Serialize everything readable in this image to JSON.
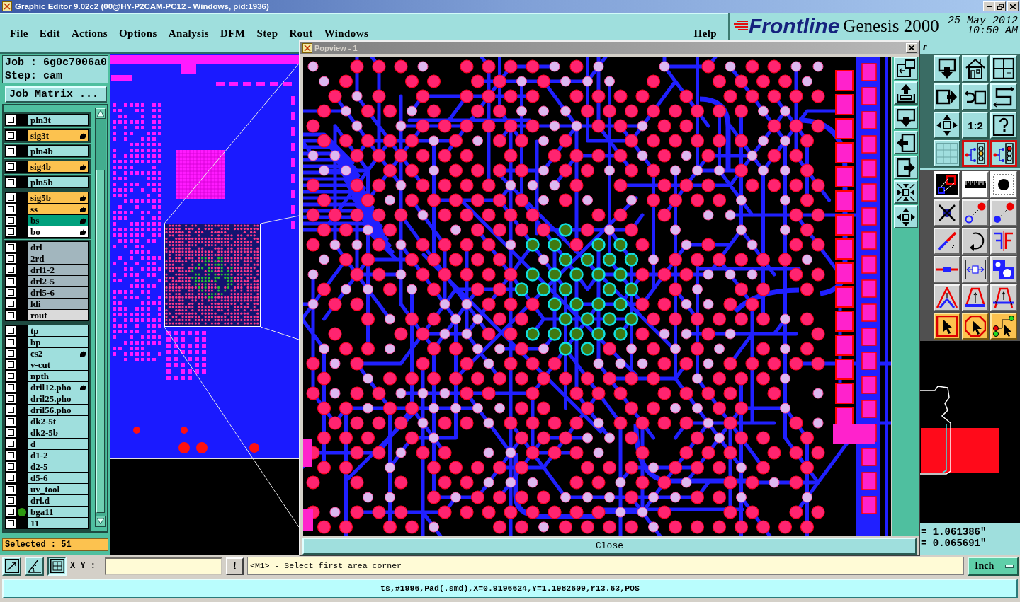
{
  "window": {
    "title": "Graphic Editor 9.02c2 (00@HY-P2CAM-PC12 - Windows, pid:1936)"
  },
  "menu": [
    "File",
    "Edit",
    "Actions",
    "Options",
    "Analysis",
    "DFM",
    "Step",
    "Rout",
    "Windows"
  ],
  "help_menu": "Help",
  "brand": {
    "logo": "Frontline",
    "product": "Genesis 2000",
    "date": "25 May 2012",
    "time": "10:50 AM",
    "subtitle": "r"
  },
  "job_panel": {
    "job": "Job : 6g0c7006a0",
    "step": "Step: cam",
    "matrix_button": "Job Matrix ...",
    "layer_groups": [
      {
        "layers": [
          {
            "name": "pln3t",
            "color": "#9fdfdd",
            "checked": false,
            "marked": false,
            "displayed": false
          }
        ]
      },
      {
        "layers": [
          {
            "name": "sig3t",
            "color": "#fcc24f",
            "checked": false,
            "marked": true,
            "displayed": false
          }
        ]
      },
      {
        "layers": [
          {
            "name": "pln4b",
            "color": "#9fdfdd",
            "checked": false,
            "marked": false,
            "displayed": false
          }
        ]
      },
      {
        "layers": [
          {
            "name": "sig4b",
            "color": "#fcc24f",
            "checked": false,
            "marked": true,
            "displayed": false
          }
        ]
      },
      {
        "layers": [
          {
            "name": "pln5b",
            "color": "#9fdfdd",
            "checked": false,
            "marked": false,
            "displayed": false
          }
        ]
      },
      {
        "layers": [
          {
            "name": "sig5b",
            "color": "#fcc24f",
            "checked": false,
            "marked": true,
            "displayed": false
          },
          {
            "name": "ss",
            "color": "#fcc24f",
            "checked": false,
            "marked": true,
            "displayed": false
          },
          {
            "name": "bs",
            "color": "#00a07c",
            "checked": false,
            "marked": true,
            "displayed": false
          },
          {
            "name": "bo",
            "color": "#ffffff",
            "checked": false,
            "marked": true,
            "displayed": false
          }
        ]
      },
      {
        "layers": [
          {
            "name": "drl",
            "color": "#a2b6be",
            "checked": false,
            "marked": false,
            "displayed": false
          },
          {
            "name": "2rd",
            "color": "#a2b6be",
            "checked": false,
            "marked": false,
            "displayed": false
          },
          {
            "name": "drl1-2",
            "color": "#a2b6be",
            "checked": false,
            "marked": false,
            "displayed": false
          },
          {
            "name": "drl2-5",
            "color": "#a2b6be",
            "checked": false,
            "marked": false,
            "displayed": false
          },
          {
            "name": "drl5-6",
            "color": "#a2b6be",
            "checked": false,
            "marked": false,
            "displayed": false
          },
          {
            "name": "ldi",
            "color": "#a2b6be",
            "checked": false,
            "marked": false,
            "displayed": false
          },
          {
            "name": "rout",
            "color": "#dadada",
            "checked": false,
            "marked": false,
            "displayed": false
          }
        ]
      },
      {
        "layers": [
          {
            "name": "tp",
            "color": "#9fdfdd",
            "checked": false,
            "marked": false,
            "displayed": false
          },
          {
            "name": "bp",
            "color": "#9fdfdd",
            "checked": false,
            "marked": false,
            "displayed": false
          },
          {
            "name": "cs2",
            "color": "#9fdfdd",
            "checked": false,
            "marked": true,
            "displayed": false
          },
          {
            "name": "v-cut",
            "color": "#9fdfdd",
            "checked": false,
            "marked": false,
            "displayed": false
          },
          {
            "name": "npth",
            "color": "#9fdfdd",
            "checked": false,
            "marked": false,
            "displayed": false
          },
          {
            "name": "dril12.pho",
            "color": "#9fdfdd",
            "checked": false,
            "marked": true,
            "displayed": false
          },
          {
            "name": "dril25.pho",
            "color": "#9fdfdd",
            "checked": false,
            "marked": false,
            "displayed": false
          },
          {
            "name": "dril56.pho",
            "color": "#9fdfdd",
            "checked": false,
            "marked": false,
            "displayed": false
          },
          {
            "name": "dk2-5t",
            "color": "#9fdfdd",
            "checked": false,
            "marked": false,
            "displayed": false
          },
          {
            "name": "dk2-5b",
            "color": "#9fdfdd",
            "checked": false,
            "marked": false,
            "displayed": false
          },
          {
            "name": "d",
            "color": "#9fdfdd",
            "checked": false,
            "marked": false,
            "displayed": false
          },
          {
            "name": "d1-2",
            "color": "#9fdfdd",
            "checked": false,
            "marked": false,
            "displayed": false
          },
          {
            "name": "d2-5",
            "color": "#9fdfdd",
            "checked": false,
            "marked": false,
            "displayed": false
          },
          {
            "name": "d5-6",
            "color": "#9fdfdd",
            "checked": false,
            "marked": false,
            "displayed": false
          },
          {
            "name": "uv_tool",
            "color": "#9fdfdd",
            "checked": false,
            "marked": false,
            "displayed": false
          },
          {
            "name": "drl.d",
            "color": "#9fdfdd",
            "checked": false,
            "marked": false,
            "displayed": false
          },
          {
            "name": "bga11",
            "color": "#9fdfdd",
            "checked": false,
            "marked": false,
            "displayed": true
          },
          {
            "name": "11",
            "color": "#9fdfdd",
            "checked": false,
            "marked": false,
            "displayed": false
          }
        ]
      }
    ],
    "selected": "Selected : 51"
  },
  "tool_palette": [
    {
      "kind": "view",
      "on": false
    },
    {
      "kind": "view",
      "on": false
    },
    {
      "kind": "view",
      "on": false
    },
    {
      "kind": "view",
      "on": false
    },
    {
      "kind": "view",
      "on": false
    },
    {
      "kind": "view",
      "on": false
    },
    {
      "kind": "view",
      "on": false
    },
    {
      "kind": "view",
      "label": "1:2",
      "on": false
    },
    {
      "kind": "view",
      "on": false
    },
    {
      "kind": "view",
      "on": false
    },
    {
      "kind": "view",
      "on": true
    },
    {
      "kind": "view",
      "on": true
    },
    {
      "kind": "display",
      "on": false
    },
    {
      "kind": "display",
      "on": false
    },
    {
      "kind": "display",
      "on": false
    },
    {
      "kind": "edit",
      "on": false
    },
    {
      "kind": "edit",
      "on": false
    },
    {
      "kind": "edit",
      "on": false
    },
    {
      "kind": "edit",
      "on": false
    },
    {
      "kind": "edit",
      "on": false
    },
    {
      "kind": "edit",
      "on": false
    },
    {
      "kind": "edit",
      "on": false
    },
    {
      "kind": "edit",
      "on": false
    },
    {
      "kind": "edit",
      "on": false
    },
    {
      "kind": "edit",
      "on": false
    },
    {
      "kind": "edit",
      "on": false
    },
    {
      "kind": "edit",
      "on": false
    },
    {
      "kind": "select",
      "on": false
    },
    {
      "kind": "select",
      "on": false
    },
    {
      "kind": "select",
      "on": false
    }
  ],
  "coordinates": [
    "= 1.061386\"",
    "= 0.065691\""
  ],
  "command_bar": {
    "xy_label": "X Y :",
    "alert_button": "!",
    "prompt": "<M1> - Select first area corner",
    "units": "Inch"
  },
  "status_bar": "ts,#1996,Pad(.smd),X=0.9196624,Y=1.1982609,r13.63,POS",
  "popview": {
    "title": "Popview - 1",
    "close_button": "Close"
  }
}
